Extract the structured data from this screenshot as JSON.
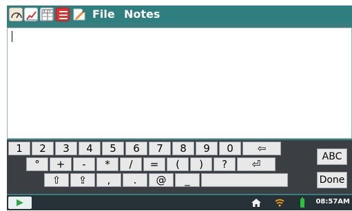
{
  "toolbar": {
    "file_label": "File",
    "notes_label": "Notes",
    "icons": [
      "meter-icon",
      "graph-icon",
      "table-icon",
      "list-icon",
      "notes-pencil-icon"
    ]
  },
  "notes": {
    "text": ""
  },
  "keyboard": {
    "row1": [
      "1",
      "2",
      "3",
      "4",
      "5",
      "6",
      "7",
      "8",
      "9",
      "0",
      "⇦"
    ],
    "row2": [
      "°",
      "+",
      "-",
      "*",
      "/",
      "=",
      "(",
      ")",
      "?",
      "⏎"
    ],
    "row3": [
      "⇧",
      "⇪",
      ",",
      ".",
      "@",
      "_",
      ""
    ],
    "abc_label": "ABC",
    "done_label": "Done"
  },
  "status": {
    "time": "08:57AM",
    "icons": [
      "play-icon",
      "home-icon",
      "wifi-icon",
      "battery-icon"
    ]
  },
  "colors": {
    "toolbar": "#2f7f80",
    "keyboard": "#3b3f44",
    "statusbar": "#263238"
  }
}
